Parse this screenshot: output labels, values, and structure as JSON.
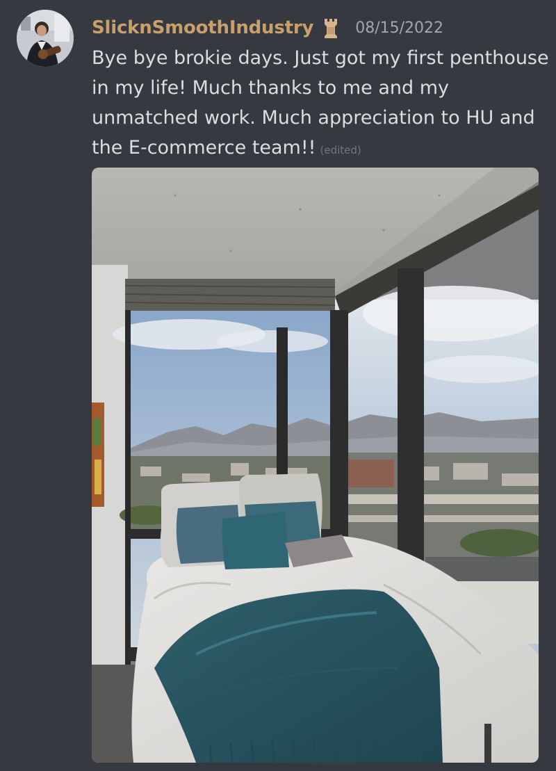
{
  "message": {
    "author": "SlicknSmoothIndustry",
    "role_icon": "chess-rook-icon",
    "timestamp": "08/15/2022",
    "content": "Bye bye brokie days. Just got my first penthouse in my life! Much thanks to me and my unmatched work. Much appreciation to HU and the E-commerce team!!",
    "edited_label": "(edited)",
    "attachment": {
      "icon": "photo-icon"
    }
  },
  "colors": {
    "background": "#36393f",
    "username": "#c9a06b",
    "text": "#dcddde",
    "timestamp": "#a3a6aa",
    "edited": "#72767d"
  }
}
